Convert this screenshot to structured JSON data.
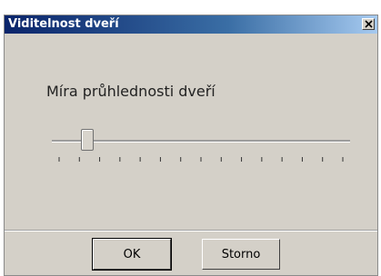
{
  "window": {
    "title": "Viditelnost dveří",
    "close_icon": "close-x-icon"
  },
  "slider": {
    "label": "Míra průhlednosti dveří",
    "value_fraction": 0.1,
    "tick_count": 15
  },
  "buttons": {
    "ok": "OK",
    "cancel": "Storno"
  },
  "colors": {
    "title_bar_start": "#0a246a",
    "title_bar_end": "#a6caf0",
    "face": "#d4d0c8"
  }
}
